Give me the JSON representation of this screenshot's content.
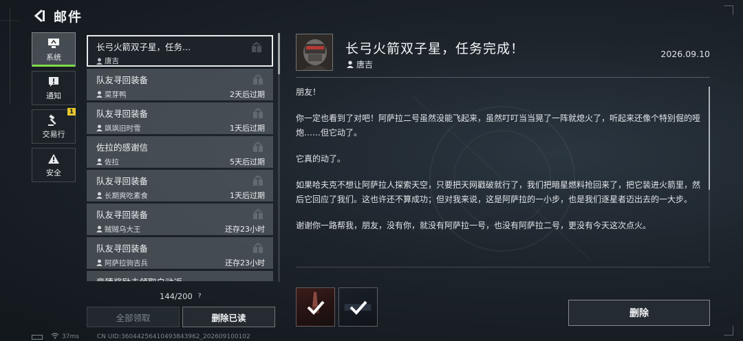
{
  "header": {
    "title": "邮件"
  },
  "categories": [
    {
      "label": "系统",
      "icon": "monitor-icon",
      "active": true
    },
    {
      "label": "通知",
      "icon": "alert-icon"
    },
    {
      "label": "交易行",
      "icon": "hammer-icon",
      "badge": "1"
    },
    {
      "label": "安全",
      "icon": "warning-icon"
    }
  ],
  "mails": [
    {
      "title": "长弓火箭双子星，任务...",
      "sender": "唐吉",
      "expiry": ""
    },
    {
      "title": "队友寻回装备",
      "sender": "菜芽鸭",
      "expiry": "2天后过期"
    },
    {
      "title": "队友寻回装备",
      "sender": "飒飒旧时雪",
      "expiry": "1天后过期"
    },
    {
      "title": "佐拉的感谢信",
      "sender": "佐拉",
      "expiry": "5天后过期"
    },
    {
      "title": "队友寻回装备",
      "sender": "长期爽吃素食",
      "expiry": "1天后过期"
    },
    {
      "title": "队友寻回装备",
      "sender": "贼贼乌大王",
      "expiry": "还存23小时"
    },
    {
      "title": "队友寻回装备",
      "sender": "阿萨拉驹吉兵",
      "expiry": "还存23小时"
    },
    {
      "title": "竞猜奖励未领取自动返",
      "sender": "",
      "expiry": ""
    }
  ],
  "list_footer": {
    "count": "144/200",
    "help": "?",
    "claim_all": "全部领取",
    "delete_read": "删除已读"
  },
  "status_bar": {
    "ping": "37ms",
    "uid": "CN UID:360442564104938439​62_202609100102"
  },
  "detail": {
    "title": "长弓火箭双子星，任务完成！",
    "sender": "唐吉",
    "date": "2026.09.10",
    "paragraphs": [
      "朋友！",
      "你一定也看到了对吧！阿萨拉二号虽然没能飞起来，虽然叮叮当当晃了一阵就熄火了，听起来还像个特别倔的哑炮……但它动了。",
      "它真的动了。",
      "如果哈夫克不想让阿萨拉人探索天空，只要把天网戳破就行了，我们把暗星燃料抢回来了，把它装进火箭里，然后它回应了我们。这也许还不算成功；但对我来说，这是阿萨拉的一小步，也是我们逐星者迈出去的一大步。",
      "谢谢你一路帮我，朋友，没有你，就没有阿萨拉一号，也没有阿萨拉二号，更没有今天这次点火。"
    ],
    "delete_label": "删除"
  },
  "colors": {
    "accent_green": "#7ddc4a",
    "badge_yellow": "#e8c830"
  }
}
